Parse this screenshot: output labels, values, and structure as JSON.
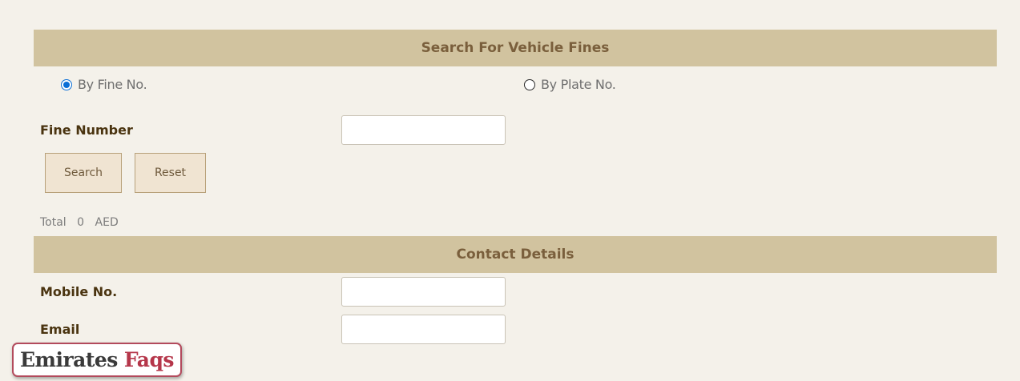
{
  "search_section": {
    "title": "Search For Vehicle Fines",
    "options": [
      {
        "label": "By Fine No.",
        "checked": true
      },
      {
        "label": "By Plate No.",
        "checked": false
      }
    ],
    "fine_number_label": "Fine Number",
    "fine_number_value": "",
    "buttons": {
      "search": "Search",
      "reset": "Reset"
    },
    "total": {
      "label": "Total",
      "amount": "0",
      "currency": "AED"
    }
  },
  "contact_section": {
    "title": "Contact Details",
    "mobile_label": "Mobile No.",
    "mobile_value": "",
    "email_label": "Email",
    "email_value": ""
  },
  "watermark": {
    "part1": "Emirates",
    "part2": "Faqs"
  },
  "colors": {
    "header_bg": "#d1c39f",
    "header_text": "#7a5f3c",
    "page_bg": "#f4f1ea",
    "label_text": "#4a3410",
    "radio_accent": "#0b6fd6",
    "button_bg": "#f0e4d2",
    "watermark_accent": "#b5364a"
  }
}
